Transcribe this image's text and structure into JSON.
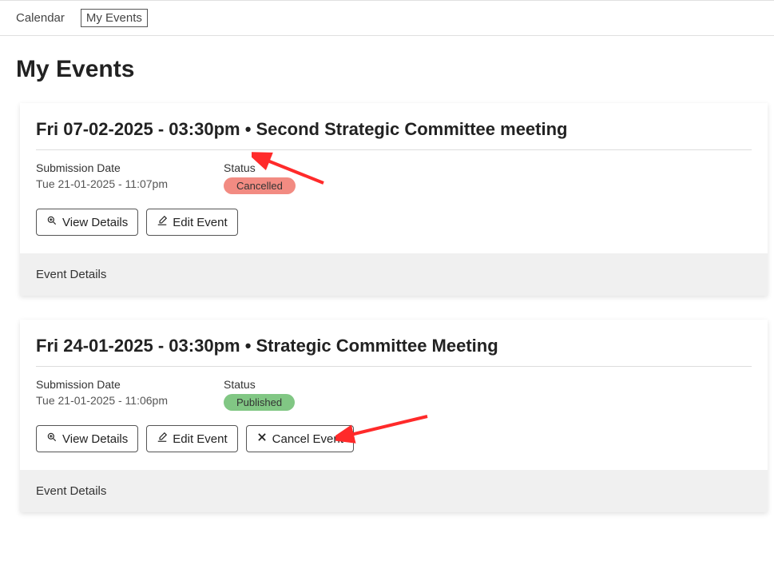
{
  "tabs": {
    "calendar": "Calendar",
    "my_events": "My Events"
  },
  "page_title": "My Events",
  "labels": {
    "submission_date": "Submission Date",
    "status": "Status",
    "view_details": "View Details",
    "edit_event": "Edit Event",
    "cancel_event": "Cancel Event",
    "event_details": "Event Details"
  },
  "status_values": {
    "cancelled": "Cancelled",
    "published": "Published"
  },
  "events": [
    {
      "title": "Fri 07-02-2025 - 03:30pm • Second Strategic Committee meeting",
      "submission": "Tue 21-01-2025 - 11:07pm",
      "status_key": "cancelled"
    },
    {
      "title": "Fri 24-01-2025 - 03:30pm • Strategic Committee Meeting",
      "submission": "Tue 21-01-2025 - 11:06pm",
      "status_key": "published"
    }
  ]
}
